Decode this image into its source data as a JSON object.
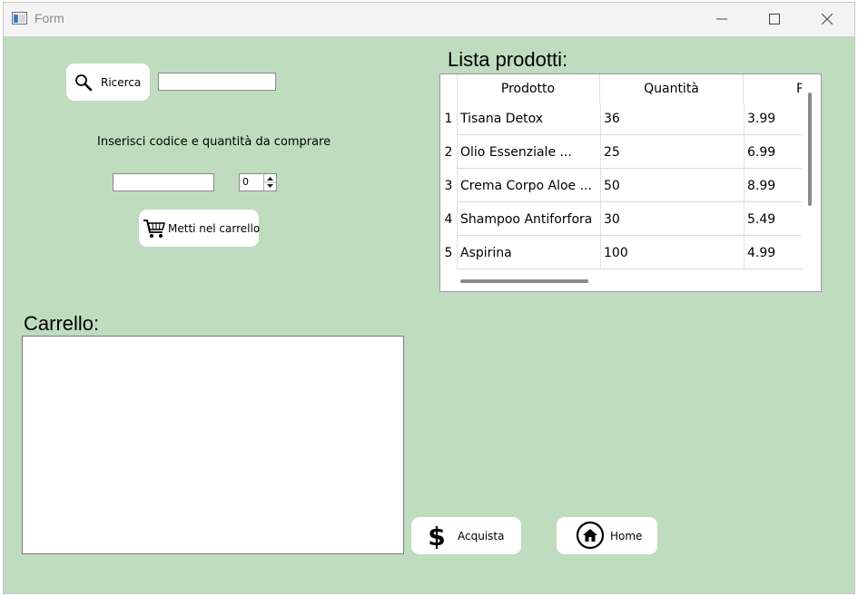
{
  "window": {
    "title": "Form"
  },
  "search": {
    "button_label": "Ricerca",
    "value": ""
  },
  "purchase": {
    "instruction": "Inserisci codice e quantità da comprare",
    "code_value": "",
    "quantity_value": "0",
    "add_button_label": "Metti nel carrello"
  },
  "products": {
    "title": "Lista prodotti:",
    "columns": [
      "Prodotto",
      "Quantità",
      "P"
    ],
    "rows": [
      {
        "num": "1",
        "name": "Tisana Detox",
        "qty": "36",
        "price": "3.99"
      },
      {
        "num": "2",
        "name": "Olio Essenziale ...",
        "qty": "25",
        "price": "6.99"
      },
      {
        "num": "3",
        "name": "Crema Corpo Aloe ...",
        "qty": "50",
        "price": "8.99"
      },
      {
        "num": "4",
        "name": "Shampoo Antiforfora",
        "qty": "30",
        "price": "5.49"
      },
      {
        "num": "5",
        "name": "Aspirina",
        "qty": "100",
        "price": "4.99"
      }
    ]
  },
  "cart": {
    "title": "Carrello:"
  },
  "actions": {
    "buy_label": "Acquista",
    "home_label": "Home"
  },
  "icons": {
    "search": "search-icon",
    "cart": "cart-icon",
    "dollar": "dollar-icon",
    "home": "home-icon"
  }
}
